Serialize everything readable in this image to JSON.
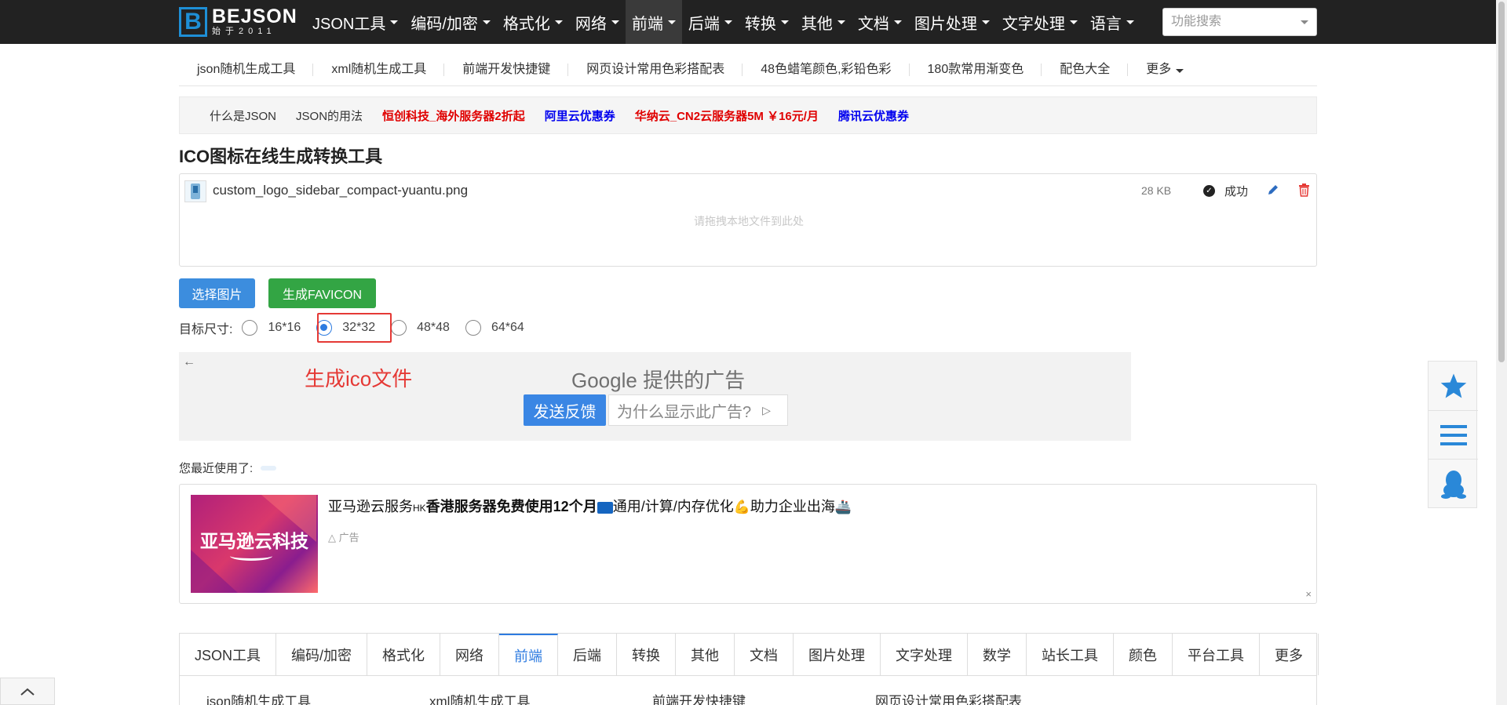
{
  "logo": {
    "mark": "B",
    "title": "BEJSON",
    "sub": "始于2011"
  },
  "topnav": {
    "items": [
      "JSON工具",
      "编码/加密",
      "格式化",
      "网络",
      "前端",
      "后端",
      "转换",
      "其他",
      "文档",
      "图片处理",
      "文字处理",
      "语言"
    ],
    "active_index": 4,
    "search_placeholder": "功能搜索"
  },
  "subnav": {
    "items": [
      "json随机生成工具",
      "xml随机生成工具",
      "前端开发快捷键",
      "网页设计常用色彩搭配表",
      "48色蜡笔颜色,彩铅色彩",
      "180款常用渐变色",
      "配色大全",
      "更多"
    ]
  },
  "links": [
    {
      "text": "什么是JSON",
      "style": "dark"
    },
    {
      "text": "JSON的用法",
      "style": "dark"
    },
    {
      "text": "恒创科技_海外服务器2折起",
      "style": "red"
    },
    {
      "text": "阿里云优惠券",
      "style": "blue"
    },
    {
      "text": "华纳云_CN2云服务器5M ￥16元/月",
      "style": "red"
    },
    {
      "text": "腾讯云优惠券",
      "style": "blue"
    }
  ],
  "page_title": "ICO图标在线生成转换工具",
  "upload": {
    "file_name": "custom_logo_sidebar_compact-yuantu.png",
    "file_size": "28 KB",
    "status": "成功",
    "drop_hint": "请拖拽本地文件到此处"
  },
  "buttons": {
    "select": "选择图片",
    "generate": "生成FAVICON"
  },
  "sizes": {
    "label": "目标尺寸:",
    "options": [
      "16*16",
      "32*32",
      "48*48",
      "64*64"
    ],
    "selected_index": 1
  },
  "ad": {
    "red_text": "生成ico文件",
    "google_brand": "Google",
    "google_text": "提供的广告",
    "feedback": "发送反馈",
    "why": "为什么显示此广告?"
  },
  "recent_label": "您最近使用了:",
  "amazon_ad": {
    "img_text": "亚马逊云科技",
    "headline_pre": "亚马逊云服务",
    "headline_hk": "HK",
    "headline_bold": "香港服务器免费使用12个月",
    "headline_mid": "通用/计算/内存优化",
    "headline_end": "助力企业出海",
    "tag": "广告",
    "close": "×"
  },
  "tabs": {
    "items": [
      "JSON工具",
      "编码/加密",
      "格式化",
      "网络",
      "前端",
      "后端",
      "转换",
      "其他",
      "文档",
      "图片处理",
      "文字处理",
      "数学",
      "站长工具",
      "颜色",
      "平台工具",
      "更多"
    ],
    "active_index": 4
  },
  "tab_content": [
    "json随机生成工具",
    "xml随机生成工具",
    "前端开发快捷键",
    "网页设计常用色彩搭配表"
  ],
  "colors": {
    "accent": "#2d7be0",
    "nav_bg": "#222222",
    "generate": "#33a544",
    "highlight": "#e53935"
  }
}
